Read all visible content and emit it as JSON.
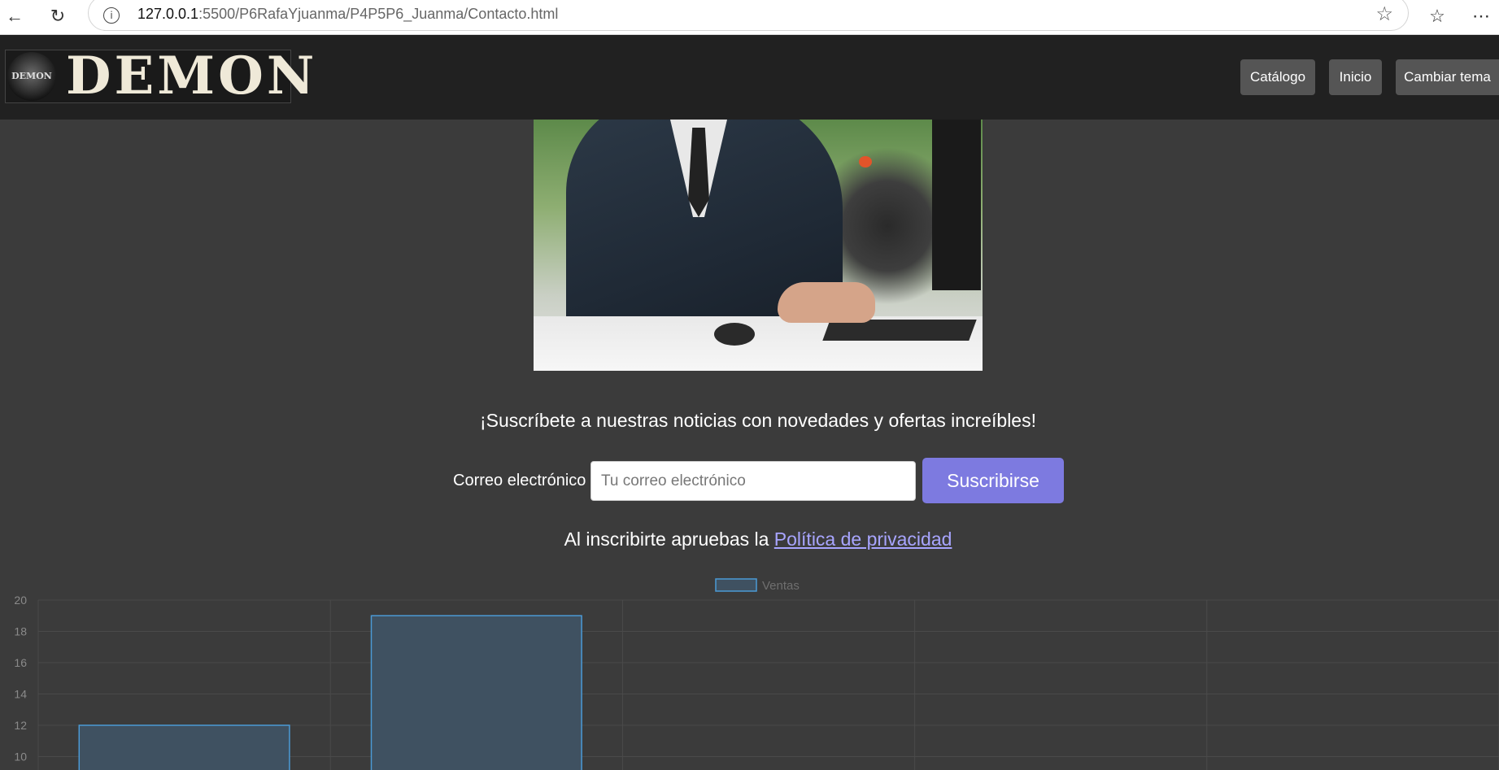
{
  "browser": {
    "url_host": "127.0.0.1",
    "url_path": ":5500/P6RafaYjuanma/P4P5P6_Juanma/Contacto.html"
  },
  "header": {
    "logo_text": "DEMON",
    "logo_emblem_text": "DEMON",
    "nav": [
      {
        "label": "Catálogo"
      },
      {
        "label": "Inicio"
      },
      {
        "label": "Cambiar tema"
      }
    ]
  },
  "subscribe": {
    "heading": "¡Suscríbete a nuestras noticias con novedades y ofertas increíbles!",
    "email_label": "Correo electrónico",
    "email_placeholder": "Tu correo electrónico",
    "email_value": "",
    "button_label": "Suscribirse",
    "privacy_prefix": "Al inscribirte apruebas la ",
    "privacy_link": "Política de privacidad"
  },
  "colors": {
    "page_bg": "#3b3b3b",
    "header_bg": "#212121",
    "accent": "#7d7ae0",
    "link": "#a8a5ff",
    "bar_fill": "#3f5161",
    "bar_border": "#4b9ad6"
  },
  "chart_data": {
    "type": "bar",
    "categories": [
      "",
      "",
      "",
      "",
      ""
    ],
    "series": [
      {
        "name": "Ventas",
        "values": [
          12,
          19,
          null,
          null,
          null
        ]
      }
    ],
    "yticks": [
      10,
      12,
      14,
      16,
      18,
      20
    ],
    "ylim": [
      10,
      20
    ],
    "legend_position": "top-center",
    "grid": true
  }
}
